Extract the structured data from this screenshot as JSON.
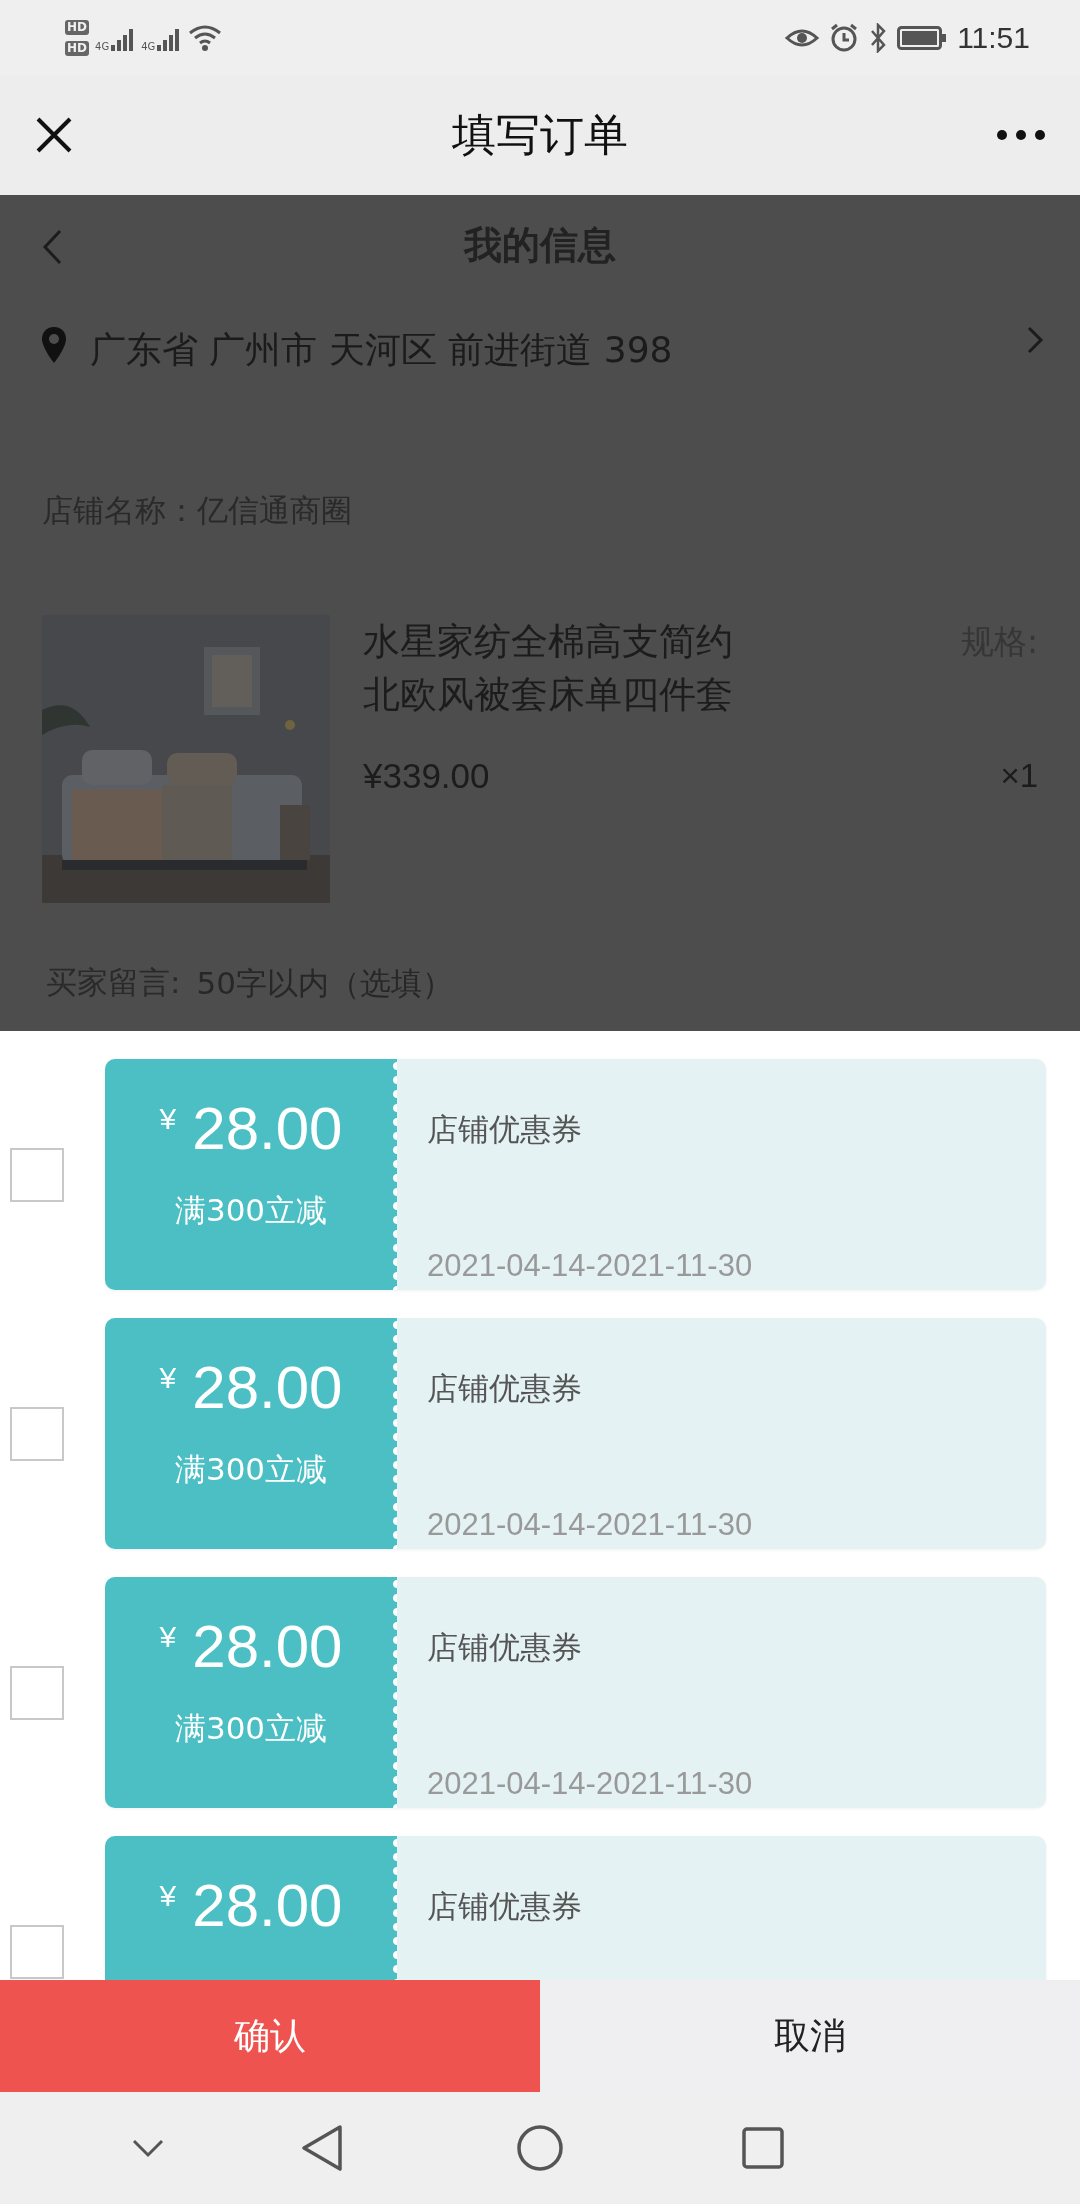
{
  "status_bar": {
    "sims": [
      {
        "badge": "HD",
        "network": "4G"
      },
      {
        "badge": "HD",
        "network": "4G"
      }
    ],
    "time": "11:51"
  },
  "nav": {
    "title": "填写订单"
  },
  "page": {
    "header": "我的信息",
    "address": "广东省 广州市 天河区 前进街道 398",
    "shop": "店铺名称：亿信通商圈",
    "product": {
      "title": "水星家纺全棉高支简约北欧风被套床单四件套",
      "spec_label": "规格:",
      "price": "¥339.00",
      "quantity": "×1"
    },
    "message": {
      "label": "买家留言:",
      "placeholder": "50字以内（选填）"
    }
  },
  "coupons": [
    {
      "currency": "¥",
      "amount": "28.00",
      "condition": "满300立减",
      "name": "店铺优惠券",
      "validity": "2021-04-14-2021-11-30",
      "checked": false
    },
    {
      "currency": "¥",
      "amount": "28.00",
      "condition": "满300立减",
      "name": "店铺优惠券",
      "validity": "2021-04-14-2021-11-30",
      "checked": false
    },
    {
      "currency": "¥",
      "amount": "28.00",
      "condition": "满300立减",
      "name": "店铺优惠券",
      "validity": "2021-04-14-2021-11-30",
      "checked": false
    },
    {
      "currency": "¥",
      "amount": "28.00",
      "name": "店铺优惠券",
      "checked": false
    }
  ],
  "buttons": [
    {
      "label": "确认",
      "kind": "primary"
    },
    {
      "label": "取消",
      "kind": "secondary"
    }
  ]
}
